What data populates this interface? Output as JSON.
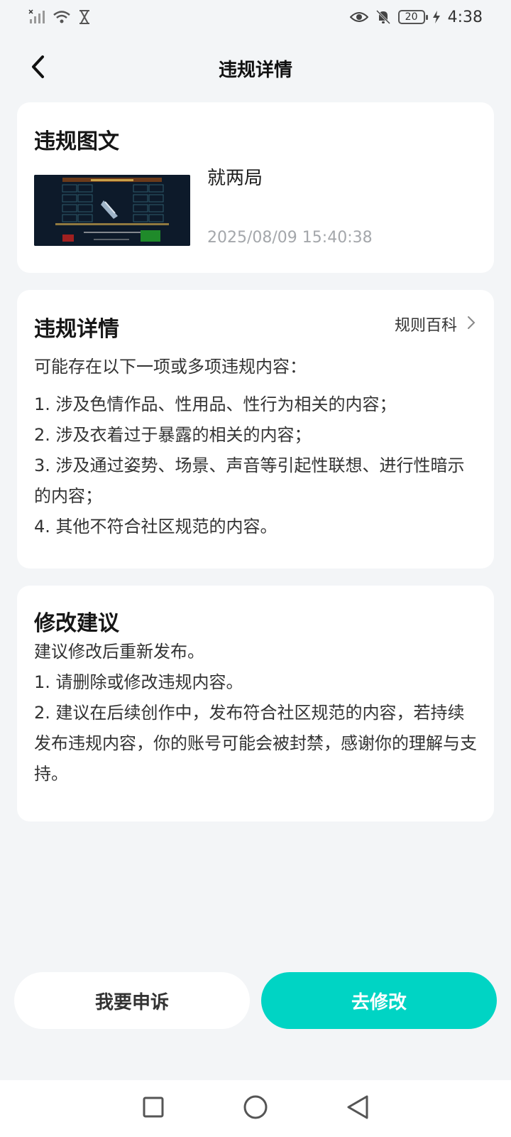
{
  "status_bar": {
    "battery_level": "20",
    "time": "4:38"
  },
  "header": {
    "title": "违规详情"
  },
  "content_card": {
    "title": "违规图文",
    "post_text": "就两局",
    "post_time": "2025/08/09 15:40:38"
  },
  "details_card": {
    "title": "违规详情",
    "rules_link_label": "规则百科",
    "intro": "可能存在以下一项或多项违规内容：",
    "items": [
      "1. 涉及色情作品、性用品、性行为相关的内容；",
      "2. 涉及衣着过于暴露的相关的内容；",
      "3. 涉及通过姿势、场景、声音等引起性联想、进行性暗示的内容；",
      "4. 其他不符合社区规范的内容。"
    ]
  },
  "suggestion_card": {
    "title": "修改建议",
    "lines": [
      "建议修改后重新发布。",
      "1. 请删除或修改违规内容。",
      "2. 建议在后续创作中，发布符合社区规范的内容，若持续发布违规内容，你的账号可能会被封禁，感谢你的理解与支持。"
    ]
  },
  "actions": {
    "appeal_label": "我要申诉",
    "edit_label": "去修改"
  },
  "icons": {
    "signal": "signal-icon",
    "wifi": "wifi-icon",
    "hourglass": "hourglass-icon",
    "eye": "eye-icon",
    "mute": "bell-off-icon",
    "charging": "bolt-icon",
    "back": "back-arrow-icon",
    "chevron": "chevron-right-icon",
    "nav_recent": "square-icon",
    "nav_home": "circle-icon",
    "nav_back": "triangle-back-icon"
  },
  "colors": {
    "accent": "#00d4c4",
    "background": "#f3f5f7",
    "card": "#ffffff",
    "muted_text": "#a4a7ab"
  }
}
